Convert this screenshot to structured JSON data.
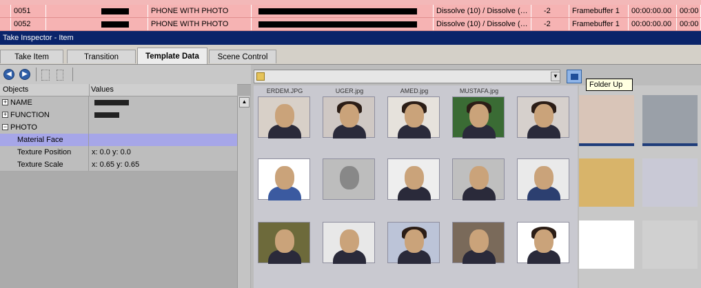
{
  "playlist": {
    "rows": [
      {
        "id": "0051",
        "type": "PHONE WITH PHOTO",
        "effect": "Dissolve (10) / Dissolve (…",
        "layer": "-2",
        "target": "Framebuffer 1",
        "time": "00:00:00.00",
        "time2": "00:00"
      },
      {
        "id": "0052",
        "type": "PHONE WITH PHOTO",
        "effect": "Dissolve (10) / Dissolve (…",
        "layer": "-2",
        "target": "Framebuffer 1",
        "time": "00:00:00.00",
        "time2": "00:00"
      }
    ]
  },
  "inspector": {
    "title": "Take Inspector - Item",
    "tabs": [
      "Take Item",
      "Transition",
      "Template Data",
      "Scene Control"
    ],
    "active_tab": "Template Data"
  },
  "grid": {
    "col_objects": "Objects",
    "col_values": "Values",
    "rows": [
      {
        "label": "NAME",
        "value": "",
        "expander": "+"
      },
      {
        "label": "FUNCTION",
        "value": "",
        "expander": "+"
      },
      {
        "label": "PHOTO",
        "value": "",
        "expander": "−"
      },
      {
        "label": "Material Face",
        "value": ""
      },
      {
        "label": "Texture Position",
        "value": "x: 0.0  y: 0.0"
      },
      {
        "label": "Texture Scale",
        "value": "x: 0.65  y: 0.65"
      }
    ]
  },
  "browser": {
    "path": "",
    "tooltip": "Folder Up",
    "top_labels": [
      "ERDEM.JPG",
      "UGER.jpg",
      "AMED.jpg",
      "MUSTAFA.jpg",
      ""
    ],
    "thumb_colors": [
      "#d8d0c8",
      "#cfc8c4",
      "#e6e2dc",
      "#3a6b34",
      "#d6d0cc",
      "#ffffff",
      "#bdbdbd",
      "#eeeeee",
      "#bfbfbf",
      "#eaeaea",
      "#6d6a3b",
      "#e8e8e8",
      "#bcc4d8",
      "#7a6a5a",
      "#ffffff"
    ]
  },
  "colors": {
    "row_bg": "#f6b3b3",
    "title_bar": "#0a246a",
    "selection": "#a6a6e8"
  }
}
